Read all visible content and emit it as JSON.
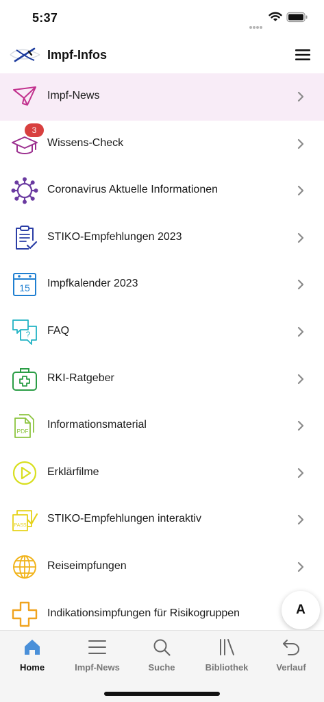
{
  "status_bar": {
    "time": "5:37"
  },
  "header": {
    "title": "Impf-Infos"
  },
  "colors": {
    "active_row_bg": "#f8ecf7",
    "badge": "#d8403f",
    "tab_active": "#4a90d9"
  },
  "menu": [
    {
      "label": "Impf-News",
      "icon": "paper-plane-icon",
      "color": "#c2328e",
      "active": true
    },
    {
      "label": "Wissens-Check",
      "icon": "graduation-cap-icon",
      "color": "#9b2f8f",
      "badge": "3"
    },
    {
      "label": "Coronavirus Aktuelle Informationen",
      "icon": "virus-icon",
      "color": "#6a3aa0"
    },
    {
      "label": "STIKO-Empfehlungen 2023",
      "icon": "clipboard-check-icon",
      "color": "#2b3ea6"
    },
    {
      "label": "Impfkalender 2023",
      "icon": "calendar-icon",
      "color": "#1f7fd1",
      "icon_text": "15"
    },
    {
      "label": "FAQ",
      "icon": "chat-question-icon",
      "color": "#21b3c4",
      "icon_text": "?"
    },
    {
      "label": "RKI-Ratgeber",
      "icon": "medical-kit-icon",
      "color": "#2a9d45"
    },
    {
      "label": "Informationsmaterial",
      "icon": "pdf-document-icon",
      "color": "#8cc43f",
      "icon_text": "PDF"
    },
    {
      "label": "Erklärfilme",
      "icon": "play-circle-icon",
      "color": "#d8df1f"
    },
    {
      "label": "STIKO-Empfehlungen interaktiv",
      "icon": "pass-check-icon",
      "color": "#e6d21a",
      "icon_text": "PASS"
    },
    {
      "label": "Reiseimpfungen",
      "icon": "globe-icon",
      "color": "#f1b31a"
    },
    {
      "label": "Indikationsimpfungen für Risikogruppen",
      "icon": "plus-cross-icon",
      "color": "#f0a31e"
    }
  ],
  "fab": {
    "label": "A"
  },
  "tabs": [
    {
      "label": "Home",
      "icon": "home-icon",
      "active": true
    },
    {
      "label": "Impf-News",
      "icon": "list-icon"
    },
    {
      "label": "Suche",
      "icon": "search-icon"
    },
    {
      "label": "Bibliothek",
      "icon": "library-icon"
    },
    {
      "label": "Verlauf",
      "icon": "history-icon"
    }
  ]
}
